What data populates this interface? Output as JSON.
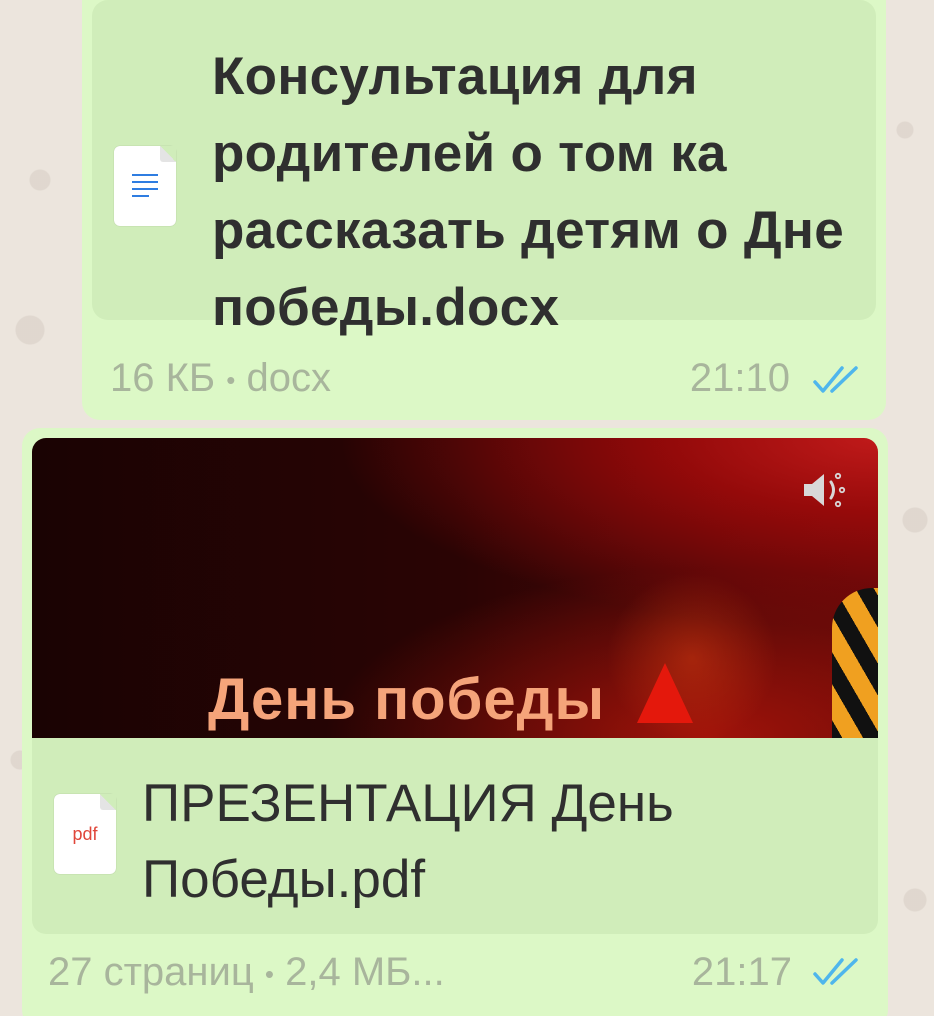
{
  "messages": [
    {
      "file_name": "Консультация для родителей о том ка рассказать детям о Дне победы.docx",
      "file_icon": "docx-icon",
      "size": "16 КБ",
      "separator": "•",
      "ext": "docx",
      "time": "21:10",
      "status": "read-double-check"
    },
    {
      "preview_title": "День победы",
      "file_name": "ПРЕЗЕНТАЦИЯ День Победы.pdf",
      "file_icon_label": "pdf",
      "pages": "27 страниц",
      "separator": "•",
      "size": "2,4 МБ...",
      "time": "21:17",
      "status": "read-double-check"
    }
  ],
  "colors": {
    "bubble": "#dcf8c6",
    "card": "#d0edba",
    "meta_text": "#a8b59c",
    "read_check": "#4fb6ec"
  }
}
